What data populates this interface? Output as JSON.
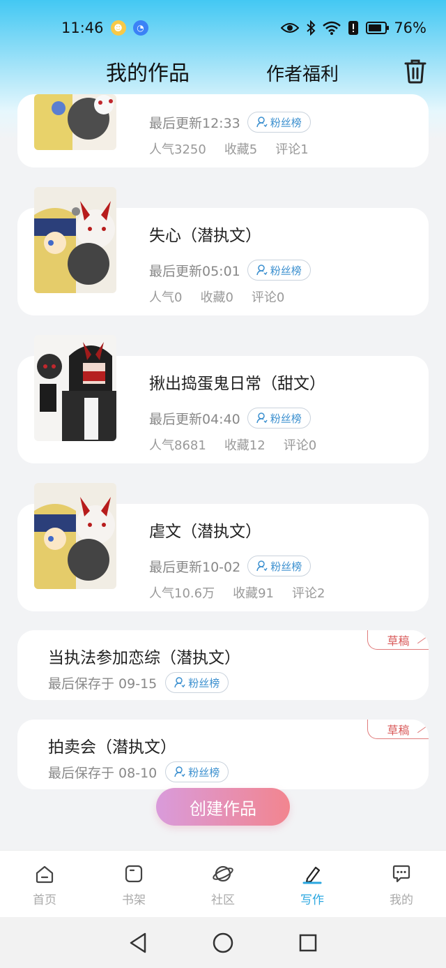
{
  "status_bar": {
    "time": "11:46",
    "battery": "76%",
    "battery_level": 0.76
  },
  "header": {
    "tab_works": "我的作品",
    "tab_welfare": "作者福利"
  },
  "fan_badge_label": "粉丝榜",
  "works": [
    {
      "title": "",
      "updated": "最后更新12:33",
      "popularity": "人气3250",
      "favorites": "收藏5",
      "comments": "评论1"
    },
    {
      "title": "失心（潜执文）",
      "updated": "最后更新05:01",
      "popularity": "人气0",
      "favorites": "收藏0",
      "comments": "评论0"
    },
    {
      "title": "揪出捣蛋鬼日常（甜文）",
      "updated": "最后更新04:40",
      "popularity": "人气8681",
      "favorites": "收藏12",
      "comments": "评论0"
    },
    {
      "title": "虐文（潜执文）",
      "updated": "最后更新10-02",
      "popularity": "人气10.6万",
      "favorites": "收藏91",
      "comments": "评论2"
    }
  ],
  "drafts": [
    {
      "title": "当执法参加恋综（潜执文）",
      "saved": "最后保存于 09-15",
      "tag": "草稿"
    },
    {
      "title": "拍卖会（潜执文）",
      "saved": "最后保存于 08-10",
      "tag": "草稿"
    }
  ],
  "create_button": "创建作品",
  "bottom_nav": [
    {
      "label": "首页",
      "icon": "home-icon"
    },
    {
      "label": "书架",
      "icon": "bookshelf-icon"
    },
    {
      "label": "社区",
      "icon": "planet-icon"
    },
    {
      "label": "写作",
      "icon": "pen-icon",
      "active": true
    },
    {
      "label": "我的",
      "icon": "chat-icon"
    }
  ],
  "colors": {
    "accent": "#2aa7e0",
    "draft": "#d95a5a",
    "header_gradient_top": "#43c8f3"
  }
}
